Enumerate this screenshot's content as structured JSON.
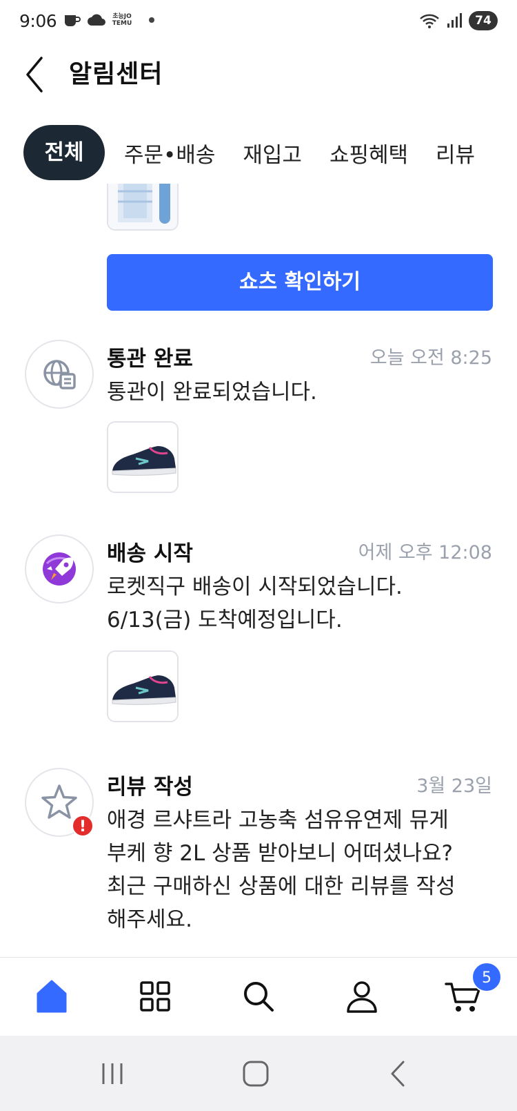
{
  "status_bar": {
    "time": "9:06",
    "temu_label_top": "초능JO",
    "temu_label_bottom": "TEMU",
    "battery": "74"
  },
  "header": {
    "title": "알림센터"
  },
  "tabs": [
    {
      "label": "전체",
      "active": true
    },
    {
      "label": "주문•배송",
      "active": false
    },
    {
      "label": "재입고",
      "active": false
    },
    {
      "label": "쇼핑혜택",
      "active": false
    },
    {
      "label": "리뷰",
      "active": false
    }
  ],
  "cta": {
    "label": "쇼츠 확인하기"
  },
  "notices": [
    {
      "title": "통관 완료",
      "time": "오늘 오전 8:25",
      "body": "통관이 완료되었습니다.",
      "icon": "customs-globe-icon",
      "has_image": true
    },
    {
      "title": "배송 시작",
      "time": "어제 오후 12:08",
      "body_lines": [
        "로켓직구 배송이 시작되었습니다.",
        "6/13(금) 도착예정입니다."
      ],
      "icon": "rocket-icon",
      "has_image": true
    },
    {
      "title": "리뷰 작성",
      "time": "3월 23일",
      "body_lines": [
        "애경 르샤트라 고농축 섬유유연제 뮤게",
        "부케 향 2L 상품 받아보니 어떠셨나요?",
        "최근 구매하신 상품에 대한 리뷰를 작성",
        "해주세요."
      ],
      "icon": "star-icon",
      "alert": "!"
    }
  ],
  "bottom_nav": {
    "items": [
      "home-icon",
      "category-grid-icon",
      "search-icon",
      "profile-icon",
      "cart-icon"
    ],
    "cart_count": "5",
    "active_color": "#346aff"
  },
  "colors": {
    "accent": "#346aff",
    "active_tab": "#1c2833",
    "muted_text": "#9aa1ad",
    "alert": "#e32c2c"
  }
}
